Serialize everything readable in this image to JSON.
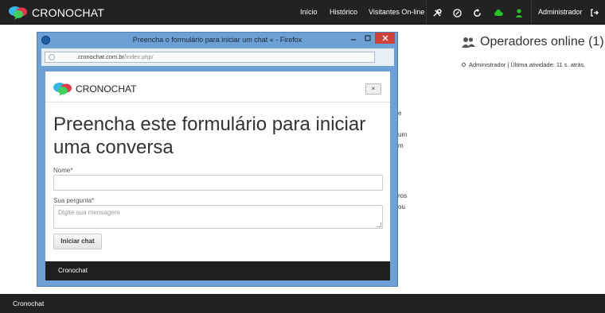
{
  "navbar": {
    "brand": "CRONOCHAT",
    "links": [
      "Início",
      "Histórico",
      "Visitantes On-line"
    ],
    "icons": [
      "tools-icon",
      "edit-icon",
      "refresh-icon",
      "cloud-icon",
      "user-icon"
    ],
    "user": "Administrador",
    "logout_icon": "logout-icon",
    "colors": {
      "bar": "#222222",
      "online": "#22c322"
    }
  },
  "operators": {
    "title": "Operadores online (1)",
    "items": [
      "Administrador | Última atividade: 11 s. atrás."
    ]
  },
  "background_fragments": [
    "e",
    "um",
    "m",
    "ros",
    "ou"
  ],
  "footer": {
    "text": "Cronochat"
  },
  "popup": {
    "window_title": "Preencha o formulário para iniciar um chat « - Firefox",
    "url_host": ".cronochat.com.br",
    "url_path": "/index.php/",
    "brand": "CRONOCHAT",
    "close_label": "×",
    "heading": "Preencha este formulário para iniciar uma conversa",
    "name_label": "Nome*",
    "name_value": "",
    "question_label": "Sua pergunta*",
    "question_placeholder": "Digite sua mensagem",
    "submit_label": "Iniciar chat",
    "footer_text": "Cronochat"
  }
}
